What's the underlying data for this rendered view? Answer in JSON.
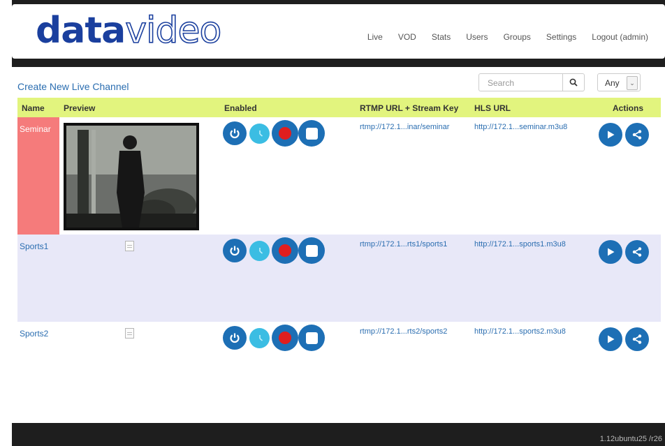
{
  "brand": {
    "logo_bold": "data",
    "logo_outline": "video"
  },
  "nav": [
    "Live",
    "VOD",
    "Stats",
    "Users",
    "Groups",
    "Settings",
    "Logout (admin)"
  ],
  "toolbar": {
    "create_label": "Create New Live Channel",
    "search_placeholder": "Search",
    "filter_value": "Any"
  },
  "columns": {
    "name": "Name",
    "preview": "Preview",
    "enabled": "Enabled",
    "rtmp": "RTMP URL + Stream Key",
    "hls": "HLS URL",
    "actions": "Actions"
  },
  "channels": [
    {
      "name": "Seminar",
      "rtmp": "rtmp://172.1...inar/seminar",
      "hls": "http://172.1...seminar.m3u8",
      "preview": "video-thumbnail"
    },
    {
      "name": "Sports1",
      "rtmp": "rtmp://172.1...rts1/sports1",
      "hls": "http://172.1...sports1.m3u8",
      "preview": "broken-image-icon"
    },
    {
      "name": "Sports2",
      "rtmp": "rtmp://172.1...rts2/sports2",
      "hls": "http://172.1...sports2.m3u8",
      "preview": "broken-image-icon"
    }
  ],
  "colors": {
    "header_row": "#e2f47e",
    "selected_name_cell": "#f57b7b",
    "alt_row": "#e8e8f8",
    "button_blue": "#1d6fb5",
    "schedule_cyan": "#3bbde3",
    "record_red": "#e01e1e"
  },
  "footer": {
    "version": "1.12ubuntu25 /r26"
  }
}
